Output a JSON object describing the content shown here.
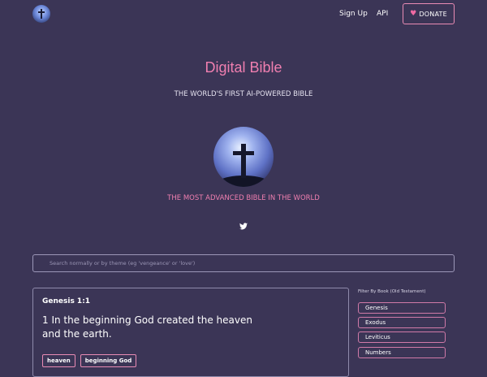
{
  "nav": {
    "logo": "cross-logo",
    "signup": "Sign Up",
    "api": "API",
    "donate": "DONATE"
  },
  "hero": {
    "title": "Digital Bible",
    "subtitle": "THE WORLD'S FIRST AI-POWERED BIBLE",
    "image": "cross-on-hill-image",
    "tagline": "THE MOST ADVANCED BIBLE IN THE WORLD",
    "social_icon": "twitter-icon"
  },
  "search": {
    "placeholder": "Search normally or by theme (eg 'vengeance' or 'love')",
    "value": ""
  },
  "verse": {
    "reference": "Genesis 1:1",
    "text": "1 In the beginning God created the heaven and the earth.",
    "tags": [
      "heaven",
      "beginning God"
    ]
  },
  "filter": {
    "label": "Filter By Book (Old Testament)",
    "books": [
      "Genesis",
      "Exodus",
      "Leviticus",
      "Numbers"
    ]
  },
  "colors": {
    "background": "#3b3556",
    "accent": "#f07fb0",
    "border": "#e98bb4"
  }
}
